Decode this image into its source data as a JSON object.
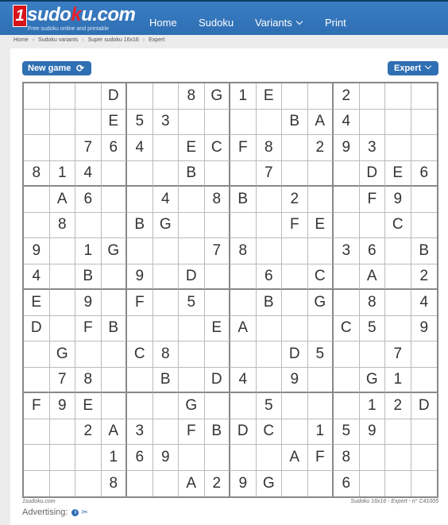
{
  "header": {
    "logo_digit": "1",
    "logo_main": "sudo",
    "logo_k": "k",
    "logo_tail": "u.com",
    "logo_subtitle": "Free sudoku online and printable",
    "nav": [
      "Home",
      "Sudoku",
      "Variants",
      "Print"
    ]
  },
  "breadcrumb": [
    "Home",
    "Sudoku variants",
    "Super sudoku 16x16",
    "Expert"
  ],
  "toolbar": {
    "new_game": "New game",
    "level": "Expert"
  },
  "grid": [
    [
      "",
      "",
      "",
      "D",
      "",
      "",
      "8",
      "G",
      "1",
      "E",
      "",
      "",
      "2",
      "",
      "",
      ""
    ],
    [
      "",
      "",
      "",
      "E",
      "5",
      "3",
      "",
      "",
      "",
      "",
      "B",
      "A",
      "4",
      "",
      "",
      ""
    ],
    [
      "",
      "",
      "7",
      "6",
      "4",
      "",
      "E",
      "C",
      "F",
      "8",
      "",
      "2",
      "9",
      "3",
      "",
      ""
    ],
    [
      "8",
      "1",
      "4",
      "",
      "",
      "",
      "B",
      "",
      "",
      "7",
      "",
      "",
      "",
      "D",
      "E",
      "6"
    ],
    [
      "",
      "A",
      "6",
      "",
      "",
      "4",
      "",
      "8",
      "B",
      "",
      "2",
      "",
      "",
      "F",
      "9",
      ""
    ],
    [
      "",
      "8",
      "",
      "",
      "B",
      "G",
      "",
      "",
      "",
      "",
      "F",
      "E",
      "",
      "",
      "C",
      ""
    ],
    [
      "9",
      "",
      "1",
      "G",
      "",
      "",
      "",
      "7",
      "8",
      "",
      "",
      "",
      "3",
      "6",
      "",
      "B"
    ],
    [
      "4",
      "",
      "B",
      "",
      "9",
      "",
      "D",
      "",
      "",
      "6",
      "",
      "C",
      "",
      "A",
      "",
      "2"
    ],
    [
      "E",
      "",
      "9",
      "",
      "F",
      "",
      "5",
      "",
      "",
      "B",
      "",
      "G",
      "",
      "8",
      "",
      "4"
    ],
    [
      "D",
      "",
      "F",
      "B",
      "",
      "",
      "",
      "E",
      "A",
      "",
      "",
      "",
      "C",
      "5",
      "",
      "9"
    ],
    [
      "",
      "G",
      "",
      "",
      "C",
      "8",
      "",
      "",
      "",
      "",
      "D",
      "5",
      "",
      "",
      "7",
      ""
    ],
    [
      "",
      "7",
      "8",
      "",
      "",
      "B",
      "",
      "D",
      "4",
      "",
      "9",
      "",
      "",
      "G",
      "1",
      ""
    ],
    [
      "F",
      "9",
      "E",
      "",
      "",
      "",
      "G",
      "",
      "",
      "5",
      "",
      "",
      "",
      "1",
      "2",
      "D"
    ],
    [
      "",
      "",
      "2",
      "A",
      "3",
      "",
      "F",
      "B",
      "D",
      "C",
      "",
      "1",
      "5",
      "9",
      "",
      ""
    ],
    [
      "",
      "",
      "",
      "1",
      "6",
      "9",
      "",
      "",
      "",
      "",
      "A",
      "F",
      "8",
      "",
      "",
      ""
    ],
    [
      "",
      "",
      "",
      "8",
      "",
      "",
      "A",
      "2",
      "9",
      "G",
      "",
      "",
      "6",
      "",
      "",
      ""
    ]
  ],
  "footer": {
    "left": "1sudoku.com",
    "right": "Sudoku 16x16 - Expert - n° C41005",
    "advertising": "Advertising:"
  }
}
